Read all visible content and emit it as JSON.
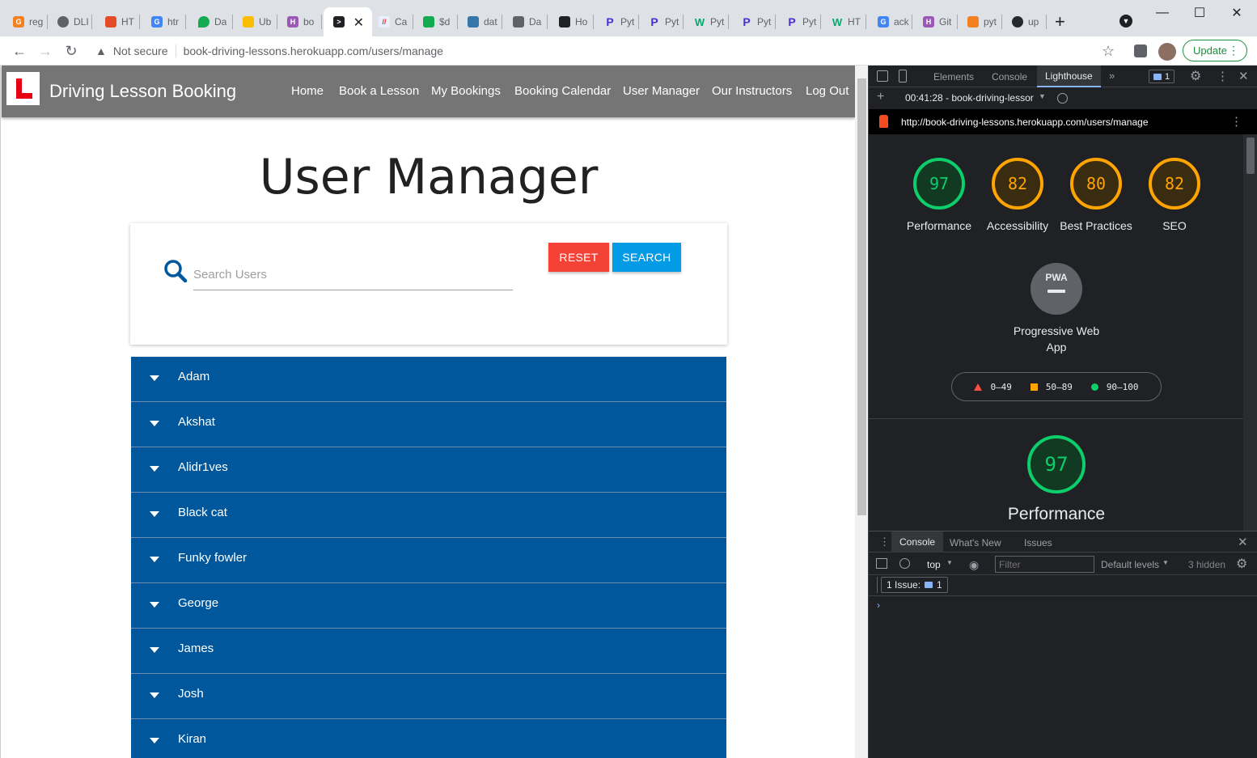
{
  "browser": {
    "tabs": [
      "reg",
      "DLI",
      "HT",
      "htr",
      "Da",
      "Ub",
      "bo",
      "",
      "Ca",
      "$d",
      "dat",
      "Da",
      "Ho",
      "Pyt",
      "Pyt",
      "Pyt",
      "Pyt",
      "Pyt",
      "HT",
      "ack",
      "Git",
      "pyt",
      "up"
    ],
    "security_label": "Not secure",
    "url": "book-driving-lessons.herokuapp.com/users/manage",
    "update_label": "Update"
  },
  "site": {
    "brand": "Driving Lesson Booking",
    "nav": [
      "Home",
      "Book a Lesson",
      "My Bookings",
      "Booking Calendar",
      "User Manager",
      "Our Instructors",
      "Log Out"
    ],
    "title": "User Manager",
    "search": {
      "placeholder": "Search Users",
      "reset_label": "RESET",
      "search_label": "SEARCH"
    },
    "users": [
      "Adam",
      "Akshat",
      "Alidr1ves",
      "Black cat",
      "Funky fowler",
      "George",
      "James",
      "Josh",
      "Kiran"
    ]
  },
  "devtools": {
    "tabs": [
      "Elements",
      "Console",
      "Lighthouse"
    ],
    "issue_count": "1",
    "report_time": "00:41:28 - book-driving-lessor",
    "report_url": "http://book-driving-lessons.herokuapp.com/users/manage",
    "scores": [
      {
        "value": "97",
        "label": "Performance",
        "status": "green"
      },
      {
        "value": "82",
        "label": "Accessibility",
        "status": "orange"
      },
      {
        "value": "80",
        "label": "Best Practices",
        "status": "orange"
      },
      {
        "value": "82",
        "label": "SEO",
        "status": "orange"
      }
    ],
    "pwa_badge": "PWA",
    "pwa_label": "Progressive Web App",
    "legend": [
      "0–49",
      "50–89",
      "90–100"
    ],
    "big_score": "97",
    "big_label": "Performance",
    "drawer": {
      "tabs": [
        "Console",
        "What's New",
        "Issues"
      ],
      "context": "top",
      "filter_placeholder": "Filter",
      "levels": "Default levels",
      "hidden": "3 hidden",
      "issues_label": "1 Issue:",
      "issues_count": "1"
    }
  },
  "colors": {
    "nav_bg": "#757575",
    "list_bg": "#01579b",
    "reset": "#f44336",
    "search": "#039be5",
    "good": "#0cce6b",
    "average": "#ffa400"
  }
}
